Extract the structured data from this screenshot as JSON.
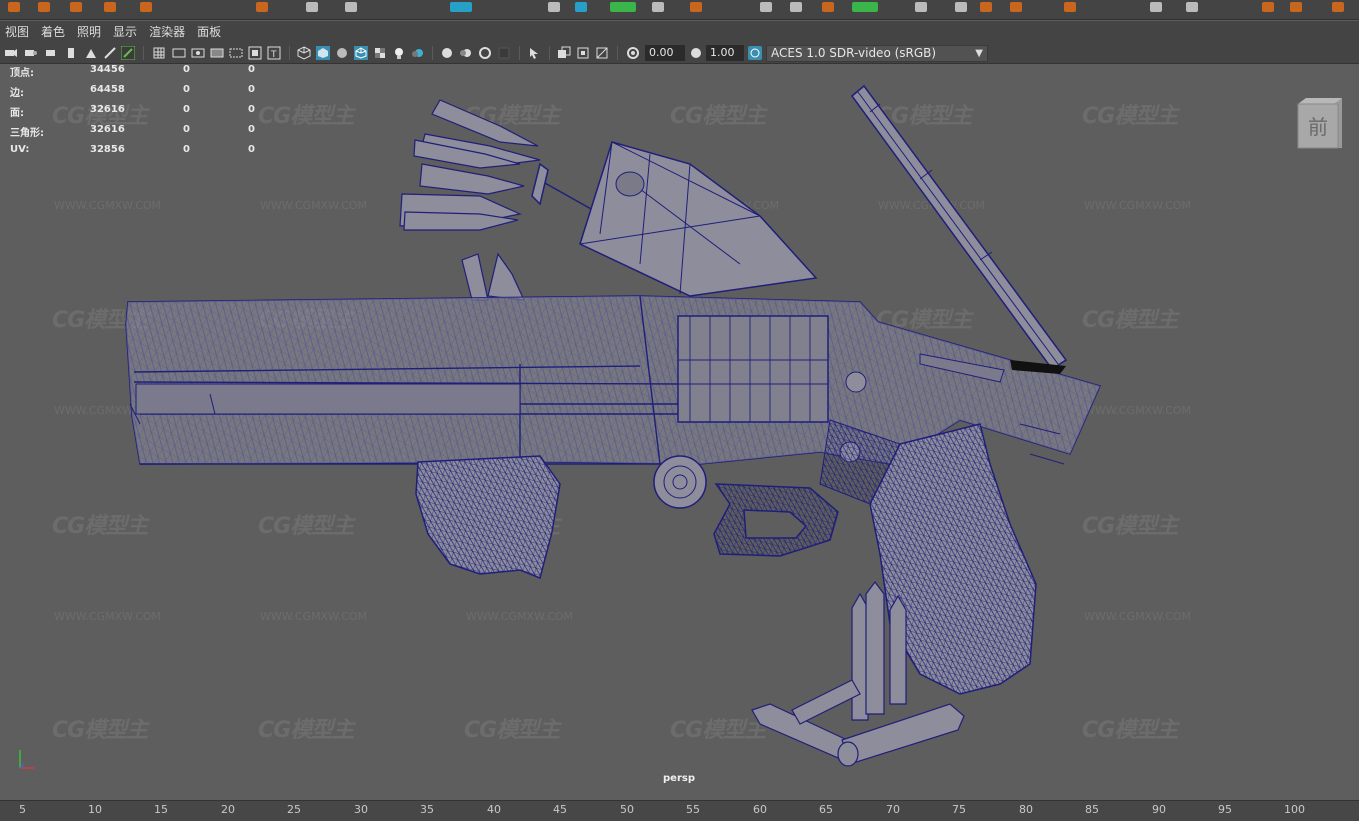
{
  "menu": {
    "items": [
      "视图",
      "着色",
      "照明",
      "显示",
      "渲染器",
      "面板"
    ]
  },
  "toolbar": {
    "exposure_value": "0.00",
    "gamma_value": "1.00",
    "colorspace": "ACES 1.0 SDR-video (sRGB)"
  },
  "hud": {
    "rows": [
      {
        "label": "顶点:",
        "v1": "34456",
        "v2": "0",
        "v3": "0"
      },
      {
        "label": "边:",
        "v1": "64458",
        "v2": "0",
        "v3": "0"
      },
      {
        "label": "面:",
        "v1": "32616",
        "v2": "0",
        "v3": "0"
      },
      {
        "label": "三角形:",
        "v1": "32616",
        "v2": "0",
        "v3": "0"
      },
      {
        "label": "UV:",
        "v1": "32856",
        "v2": "0",
        "v3": "0"
      }
    ]
  },
  "viewcube": {
    "face_label": "前"
  },
  "viewport": {
    "camera": "persp"
  },
  "watermark": {
    "logo": "CG模型主",
    "url": "WWW.CGMXW.COM"
  },
  "timeline": {
    "ticks": [
      "5",
      "10",
      "15",
      "20",
      "25",
      "30",
      "35",
      "40",
      "45",
      "50",
      "55",
      "60",
      "65",
      "70",
      "75",
      "80",
      "85",
      "90",
      "95",
      "100"
    ]
  },
  "colors": {
    "wire": "#1f1f7a",
    "mesh_fill": "#8c8c9a",
    "viewport_bg": "#5e5e5e",
    "ui_bg": "#444444"
  }
}
